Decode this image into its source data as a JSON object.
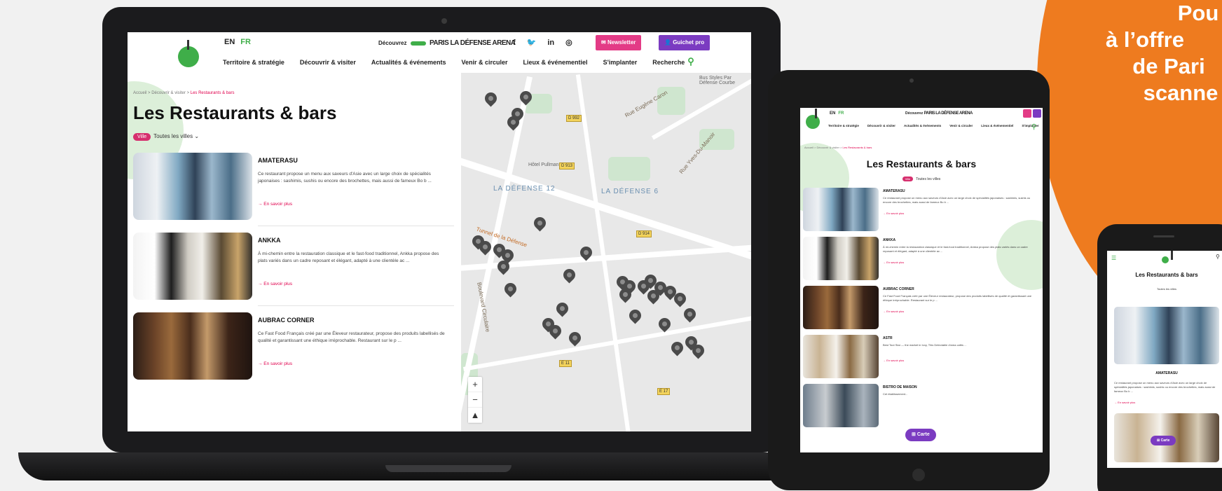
{
  "promo": {
    "lines": [
      "Pou",
      "à l’offre",
      "de Pari",
      "scanne"
    ],
    "color": "#ee7b1f"
  },
  "site": {
    "lang": {
      "en": "EN",
      "fr": "FR"
    },
    "discover": "Découvrez",
    "arena": "PARIS LA DÉFENSE ARENA",
    "social": [
      "f",
      "🐦",
      "in",
      "◎"
    ],
    "newsletter": "Newsletter",
    "guichet": "Guichet pro",
    "nav": [
      "Territoire & stratégie",
      "Découvrir & visiter",
      "Actualités & événements",
      "Venir & circuler",
      "Lieux & événementiel",
      "S'implanter",
      "Recherche"
    ],
    "breadcrumb": {
      "home": "Accueil",
      "sep": ">",
      "parent": "Découvrir & visiter",
      "current": "Les Restaurants & bars"
    },
    "title": "Les Restaurants & bars",
    "filter_tag": "Ville",
    "filter_value": "Toutes les villes",
    "more": "→ En savoir plus",
    "colors": {
      "accent_green": "#3fae49",
      "pink": "#e0004d",
      "purple": "#7b3bc1",
      "newsletter": "#e33b86"
    }
  },
  "restaurants": [
    {
      "name": "AMATERASU",
      "desc": "Ce restaurant propose un menu aux saveurs d'Asie avec un large choix de spécialités japonaises : sashimis, sushis ou encore des brochettes, mais aussi de fameux Bo b ..."
    },
    {
      "name": "ANKKA",
      "desc": "À mi-chemin entre la restauration classique et le fast-food traditionnel, Ankka propose des plats variés dans un cadre reposant et élégant, adapté à une clientèle ac ..."
    },
    {
      "name": "AUBRAC CORNER",
      "desc": "Ce Fast Food Français créé par une Éleveur restaurateur, propose des produits labellisés de qualité et garantissant une éthique irréprochable. Restaurant sur le p ..."
    }
  ],
  "tablet": {
    "extra": [
      {
        "name": "ASTR",
        "desc": "Best Tout Star — the market in Ivoy, This Delectable d'area cafés ..."
      },
      {
        "name": "BISTRO DE MAISON",
        "desc": "Cet établissement..."
      }
    ],
    "carte": "Carte"
  },
  "map": {
    "labels": [
      "LA DÉFENSE 12",
      "LA DÉFENSE 6"
    ],
    "streets": [
      "Rue Eugène Caron",
      "Rue Yves-Du-Manoir",
      "Tunnel de la Défense",
      "Boulevard Circulaire",
      "Hôtel Pullman"
    ],
    "corner_note": "Bus Styles Par Défense Courbe",
    "zoom": [
      "+",
      "−",
      "▲"
    ],
    "road_codes": [
      "D 913",
      "D 992",
      "E 11",
      "E 17",
      "D 914"
    ]
  }
}
